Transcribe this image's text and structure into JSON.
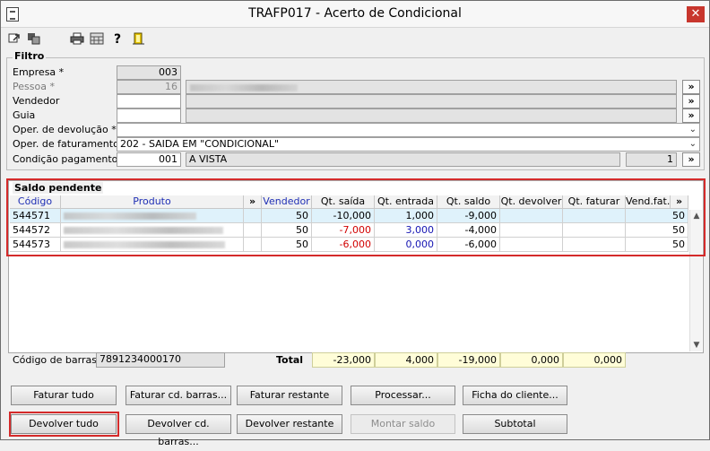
{
  "window": {
    "title": "TRAFP017 - Acerto de Condicional",
    "close": "✕"
  },
  "toolbar": {
    "icons": [
      "back-icon",
      "copy-icon",
      "printer-icon",
      "calculator-icon",
      "help-icon",
      "exit-door-icon"
    ],
    "help_glyph": "?"
  },
  "filtro": {
    "title": "Filtro",
    "empresa_label": "Empresa *",
    "empresa_value": "003",
    "pessoa_label": "Pessoa *",
    "pessoa_value": "16",
    "vendedor_label": "Vendedor",
    "guia_label": "Guia",
    "oper_dev_label": "Oper. de devolução *",
    "oper_fat_label": "Oper. de faturamento *",
    "oper_fat_value": "202 - SAIDA EM \"CONDICIONAL\"",
    "cond_label": "Condição pagamento *",
    "cond_code": "001",
    "cond_desc": "A VISTA",
    "cond_parcelas": "1",
    "lookup_label": "»"
  },
  "grid": {
    "title": "Saldo pendente",
    "more_label": "»",
    "headers": [
      "Código",
      "Produto",
      "»",
      "Vendedor",
      "Qt. saída",
      "Qt. entrada",
      "Qt. saldo",
      "Qt. devolver",
      "Qt. faturar",
      "Vend.fat.",
      "»"
    ],
    "rows": [
      {
        "codigo": "544571",
        "vendedor": "50",
        "qt_saida": "-10,000",
        "qt_entrada": "1,000",
        "qt_saldo": "-9,000",
        "qt_devolver": "",
        "qt_faturar": "",
        "vend_fat": "50"
      },
      {
        "codigo": "544572",
        "vendedor": "50",
        "qt_saida": "-7,000",
        "qt_entrada": "3,000",
        "qt_saldo": "-4,000",
        "qt_devolver": "",
        "qt_faturar": "",
        "vend_fat": "50"
      },
      {
        "codigo": "544573",
        "vendedor": "50",
        "qt_saida": "-6,000",
        "qt_entrada": "0,000",
        "qt_saldo": "-6,000",
        "qt_devolver": "",
        "qt_faturar": "",
        "vend_fat": "50"
      }
    ]
  },
  "footer": {
    "barcode_label": "Código de barras",
    "barcode_value": "7891234000170",
    "total_label": "Total",
    "total_saida": "-23,000",
    "total_entrada": "4,000",
    "total_saldo": "-19,000",
    "total_devolver": "0,000",
    "total_faturar": "0,000"
  },
  "buttons": {
    "faturar_tudo": "Faturar tudo",
    "faturar_cd_barras": "Faturar cd. barras...",
    "faturar_restante": "Faturar restante",
    "processar": "Processar...",
    "ficha_cliente": "Ficha do cliente...",
    "devolver_tudo": "Devolver tudo",
    "devolver_cd_barras": "Devolver cd. barras...",
    "devolver_restante": "Devolver restante",
    "montar_saldo": "Montar saldo",
    "subtotal": "Subtotal"
  },
  "colors": {
    "highlight": "#d42a2a",
    "selected_row": "#dff2fb",
    "total_bg": "#fffdd8",
    "negative": "#d10000",
    "zero_blue": "#1515b3"
  }
}
